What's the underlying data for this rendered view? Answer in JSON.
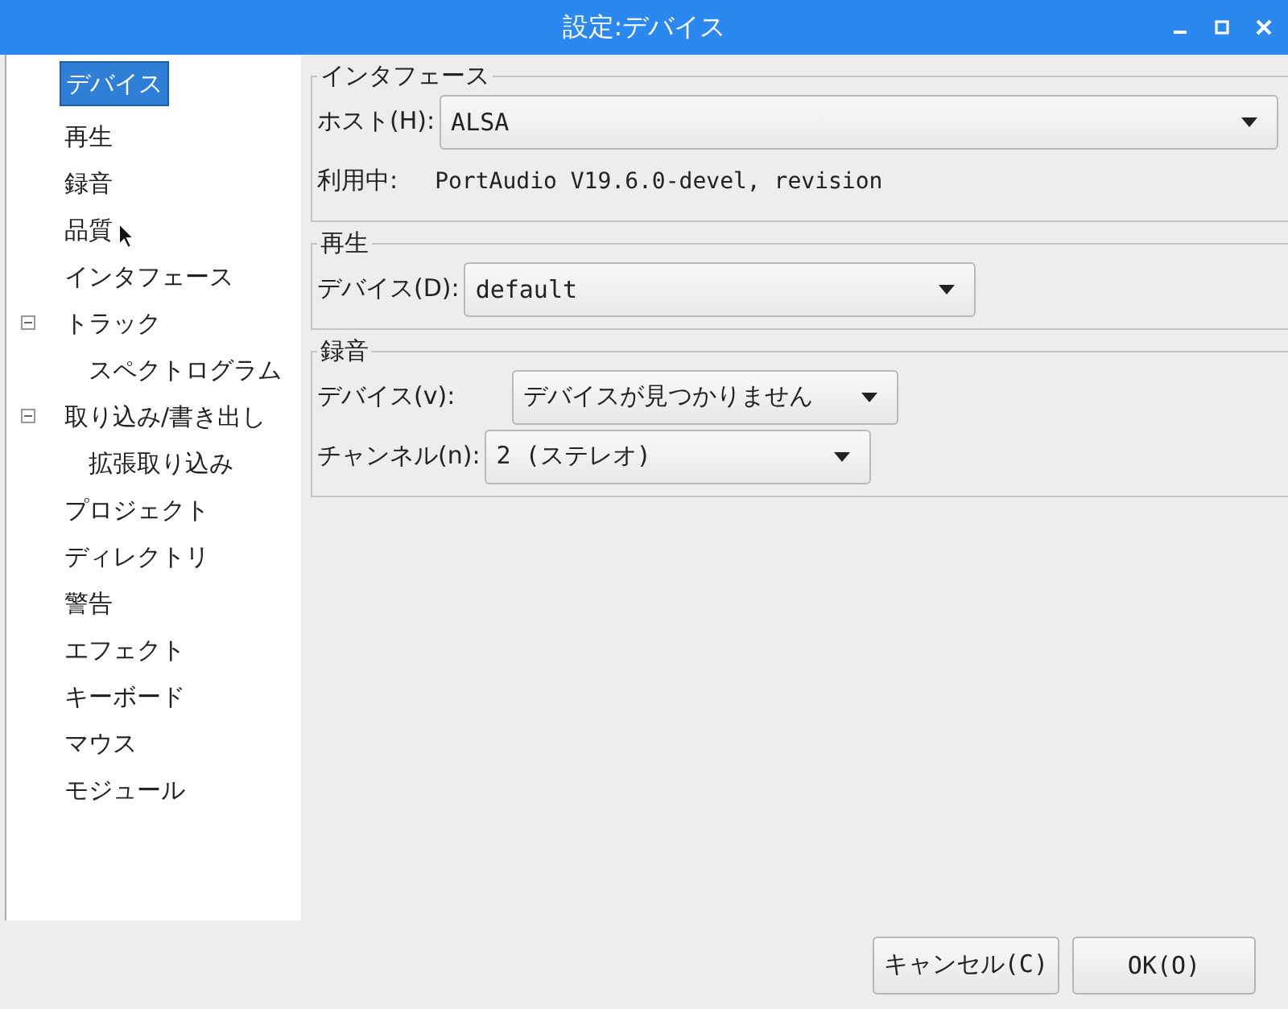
{
  "window": {
    "title": "設定:デバイス"
  },
  "sidebar": {
    "items": [
      {
        "label": "デバイス",
        "selected": true
      },
      {
        "label": "再生",
        "selected": false
      },
      {
        "label": "録音",
        "selected": false
      },
      {
        "label": "品質",
        "selected": false
      },
      {
        "label": "インタフェース",
        "selected": false
      },
      {
        "label": "トラック",
        "selected": false,
        "expanded": true,
        "children": [
          {
            "label": "スペクトログラム",
            "selected": false
          }
        ]
      },
      {
        "label": "取り込み/書き出し",
        "selected": false,
        "expanded": true,
        "children": [
          {
            "label": "拡張取り込み",
            "selected": false
          }
        ]
      },
      {
        "label": "プロジェクト",
        "selected": false
      },
      {
        "label": "ディレクトリ",
        "selected": false
      },
      {
        "label": "警告",
        "selected": false
      },
      {
        "label": "エフェクト",
        "selected": false
      },
      {
        "label": "キーボード",
        "selected": false
      },
      {
        "label": "マウス",
        "selected": false
      },
      {
        "label": "モジュール",
        "selected": false
      }
    ]
  },
  "groups": [
    {
      "title": "インタフェース",
      "rows": [
        {
          "kind": "dropdown",
          "label": "ホスト(H):",
          "value": "ALSA"
        },
        {
          "kind": "info",
          "label": "利用中:",
          "value": "PortAudio V19.6.0-devel, revision"
        }
      ]
    },
    {
      "title": "再生",
      "rows": [
        {
          "kind": "dropdown",
          "label": "デバイス(D):",
          "value": "default"
        }
      ]
    },
    {
      "title": "録音",
      "rows": [
        {
          "kind": "dropdown",
          "label": "デバイス(v):",
          "value": "デバイスが見つかりません"
        },
        {
          "kind": "dropdown",
          "label": "チャンネル(n):",
          "value": "2 (ステレオ)"
        }
      ]
    }
  ],
  "buttons": [
    "キャンセル(C)",
    "OK(O)"
  ]
}
